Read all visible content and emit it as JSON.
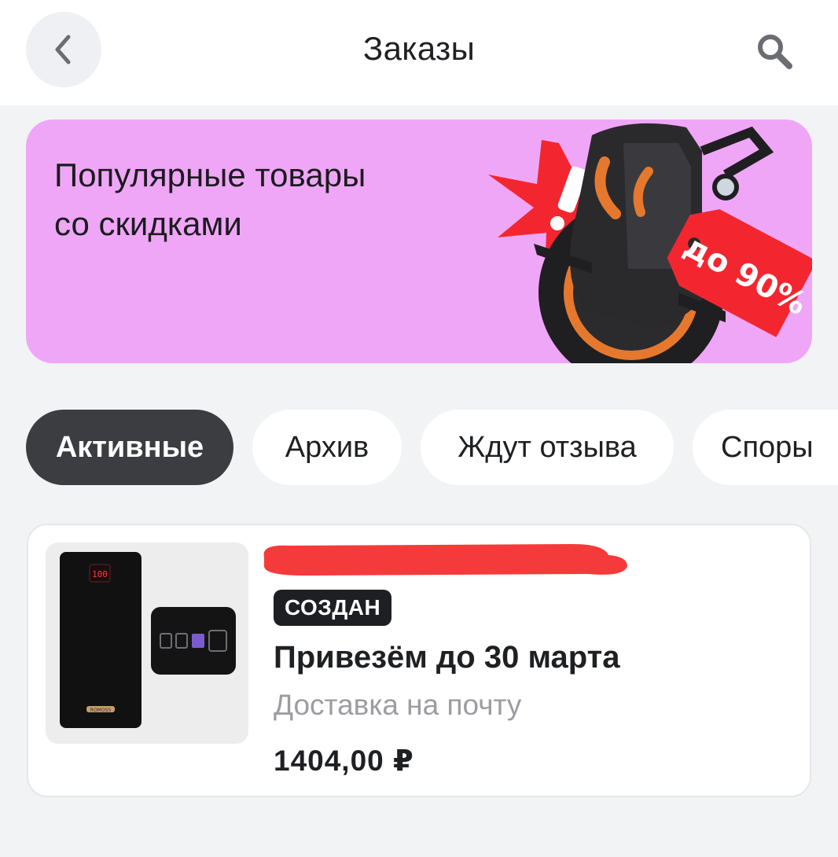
{
  "header": {
    "title": "Заказы",
    "back_icon": "chevron-left-icon",
    "search_icon": "search-icon"
  },
  "banner": {
    "text": "Популярные товары\nсо скидками",
    "tag_text": "до 90%",
    "colors": {
      "background": "#f0a6f7",
      "tag": "#f3262f"
    }
  },
  "tabs": [
    {
      "label": "Активные",
      "active": true
    },
    {
      "label": "Архив",
      "active": false
    },
    {
      "label": "Ждут отзыва",
      "active": false
    },
    {
      "label": "Споры",
      "active": false
    }
  ],
  "order": {
    "status": "СОЗДАН",
    "delivery_date": "Привезём до 30 марта",
    "delivery_method": "Доставка на почту",
    "price": "1404,00 ₽",
    "product_display": "100",
    "product_brand": "ROMOSS"
  }
}
